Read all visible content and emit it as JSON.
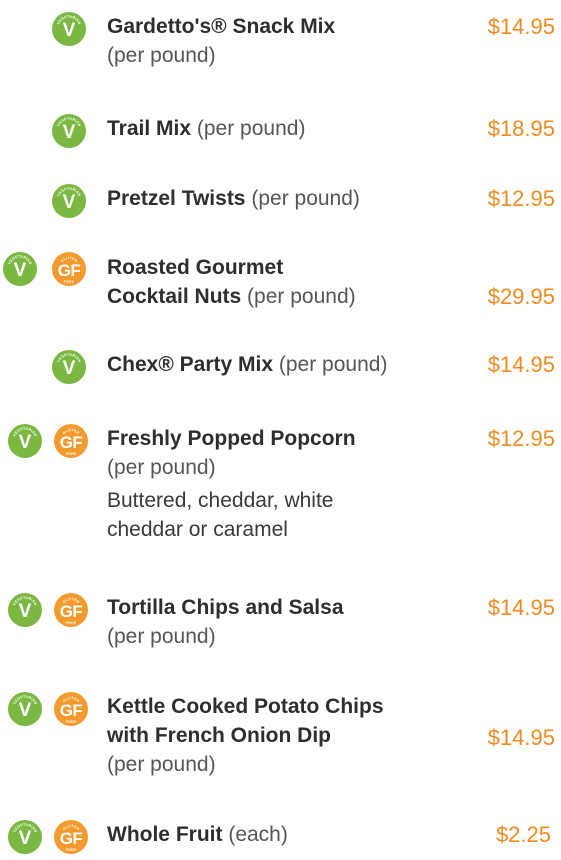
{
  "badge_labels": {
    "vegetarian_letter": "V",
    "vegetarian_text": "VEGETARIAN",
    "gluten_letter": "GF",
    "gluten_top": "GLUTEN",
    "gluten_bottom": "FREE"
  },
  "colors": {
    "vegetarian": "#7ab841",
    "gluten_free": "#f39a2e",
    "price": "#ef8a20"
  },
  "items": [
    {
      "name": "Gardetto's® Snack Mix",
      "note": "(per pound)",
      "price": "$14.95",
      "vegetarian": true,
      "gluten_free": false
    },
    {
      "name": "Trail Mix",
      "note": "(per pound)",
      "price": "$18.95",
      "vegetarian": true,
      "gluten_free": false
    },
    {
      "name": "Pretzel Twists",
      "note": "(per pound)",
      "price": "$12.95",
      "vegetarian": true,
      "gluten_free": false
    },
    {
      "name_line1": "Roasted Gourmet",
      "name_line2": "Cocktail Nuts",
      "note": "(per pound)",
      "price": "$29.95",
      "vegetarian": true,
      "gluten_free": true
    },
    {
      "name": "Chex® Party Mix",
      "note": "(per pound)",
      "price": "$14.95",
      "vegetarian": true,
      "gluten_free": false
    },
    {
      "name": "Freshly Popped Popcorn",
      "note": "(per pound)",
      "extra": "Buttered, cheddar, white cheddar or caramel",
      "price": "$12.95",
      "vegetarian": true,
      "gluten_free": true
    },
    {
      "name": "Tortilla Chips and Salsa",
      "note": "(per pound)",
      "price": "$14.95",
      "vegetarian": true,
      "gluten_free": true
    },
    {
      "name_line1": "Kettle Cooked Potato Chips",
      "name_line2": "with French Onion Dip",
      "note": "(per pound)",
      "price": "$14.95",
      "vegetarian": true,
      "gluten_free": true
    },
    {
      "name": "Whole Fruit",
      "note": "(each)",
      "price": "$2.25",
      "vegetarian": true,
      "gluten_free": true
    }
  ]
}
